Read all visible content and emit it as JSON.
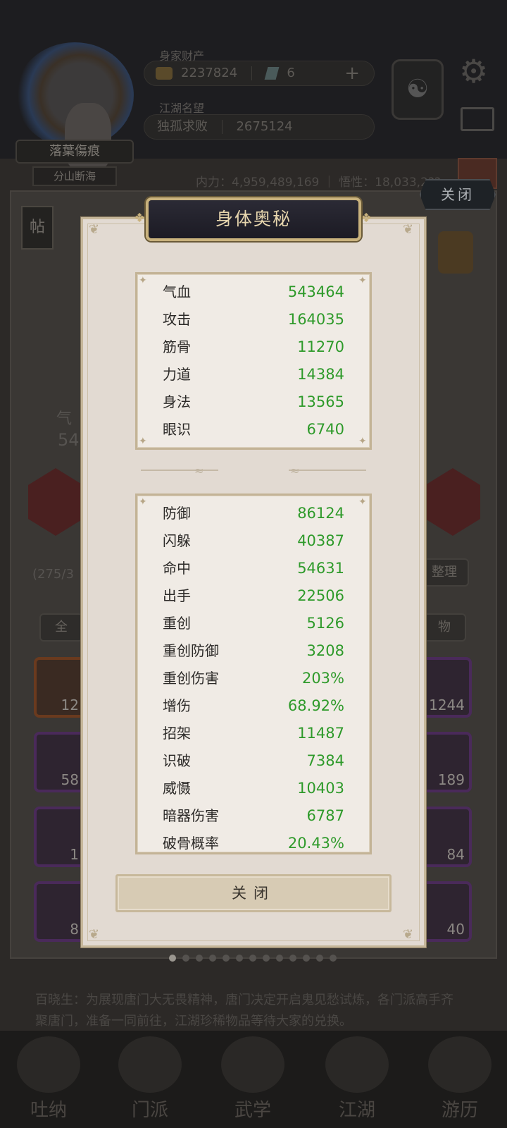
{
  "header": {
    "player_name": "落葉傷痕",
    "player_sect": "分山断海",
    "wealth_label": "身家财产",
    "gold": "2237824",
    "gems": "6",
    "add_symbol": "+",
    "fame_label": "江湖名望",
    "fame_title": "独孤求败",
    "fame_value": "2675124",
    "stats_line": "内力：4,959,489,169 ｜ 悟性：18,033,2??"
  },
  "background": {
    "side_tag": "帖",
    "top_close": "关闭",
    "partial_left": "(275/3",
    "partial_sort": "整理",
    "filter_left": "全",
    "filter_right": "物",
    "partial_hp_label": "气",
    "partial_hp_value": "54",
    "items_right_counts": [
      "1244",
      "189",
      "84",
      "40"
    ],
    "items_left_counts": [
      "12",
      "58",
      "1",
      "8"
    ],
    "story_text": "百晓生：为展现唐门大无畏精神，唐门决定开启鬼见愁试炼，各门派高手齐聚唐门，准备一同前往，江湖珍稀物品等待大家的兑换。",
    "nav": [
      "吐纳",
      "门派",
      "武学",
      "江湖",
      "游历"
    ]
  },
  "modal": {
    "title": "身体奥秘",
    "primary_stats": [
      {
        "name": "气血",
        "value": "543464"
      },
      {
        "name": "攻击",
        "value": "164035"
      },
      {
        "name": "筋骨",
        "value": "11270"
      },
      {
        "name": "力道",
        "value": "14384"
      },
      {
        "name": "身法",
        "value": "13565"
      },
      {
        "name": "眼识",
        "value": "6740"
      }
    ],
    "secondary_stats": [
      {
        "name": "防御",
        "value": "86124"
      },
      {
        "name": "闪躲",
        "value": "40387"
      },
      {
        "name": "命中",
        "value": "54631"
      },
      {
        "name": "出手",
        "value": "22506"
      },
      {
        "name": "重创",
        "value": "5126"
      },
      {
        "name": "重创防御",
        "value": "3208"
      },
      {
        "name": "重创伤害",
        "value": "203%"
      },
      {
        "name": "增伤",
        "value": "68.92%"
      },
      {
        "name": "招架",
        "value": "11487"
      },
      {
        "name": "识破",
        "value": "7384"
      },
      {
        "name": "威慑",
        "value": "10403"
      },
      {
        "name": "暗器伤害",
        "value": "6787"
      },
      {
        "name": "破骨概率",
        "value": "20.43%"
      }
    ],
    "close_label": "关闭",
    "page_count": 13,
    "active_page": 1
  }
}
